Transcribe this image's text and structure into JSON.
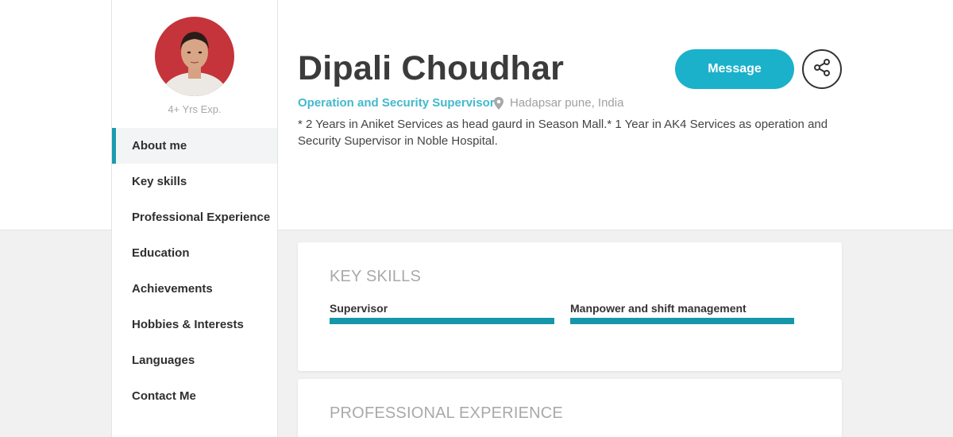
{
  "profile": {
    "name": "Dipali Choudhar",
    "title": "Operation and Security Supervisor",
    "location": "Hadapsar pune, India",
    "experience": "4+ Yrs Exp.",
    "summary": "* 2 Years in Aniket Services as head gaurd in Season Mall.* 1 Year in AK4 Services as operation and Security Supervisor in Noble Hospital."
  },
  "actions": {
    "message_label": "Message",
    "share_icon": "share-icon"
  },
  "sidebar": {
    "items": [
      {
        "label": "About me",
        "active": true
      },
      {
        "label": "Key skills"
      },
      {
        "label": "Professional Experience"
      },
      {
        "label": "Education"
      },
      {
        "label": "Achievements"
      },
      {
        "label": "Hobbies & Interests"
      },
      {
        "label": "Languages"
      },
      {
        "label": "Contact Me"
      }
    ]
  },
  "sections": {
    "key_skills": {
      "heading": "KEY SKILLS",
      "skills": [
        {
          "name": "Supervisor",
          "level": 1.0
        },
        {
          "name": "Manpower and shift management",
          "level": 1.0
        }
      ]
    },
    "professional_experience": {
      "heading": "PROFESSIONAL EXPERIENCE"
    }
  },
  "colors": {
    "accent": "#1bb1cb",
    "title": "#42b9cc",
    "skill_bar": "#1597a9",
    "active_marker": "#1a9bb0"
  }
}
